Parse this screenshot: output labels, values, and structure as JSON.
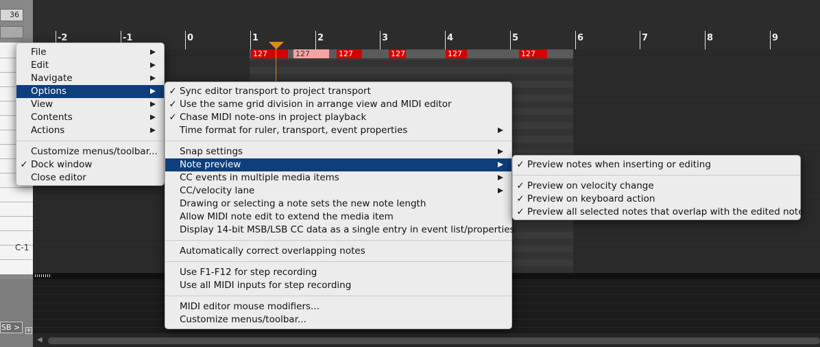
{
  "editor": {
    "zoom_value": "36",
    "key_label": "C-1",
    "cc_lane_label": "SB >",
    "add_lane_symbol": "+",
    "scroll_left_symbol": "◀",
    "ruler_labels": [
      "-2",
      "-1",
      "0",
      "1",
      "2",
      "3",
      "4",
      "5",
      "6",
      "7",
      "8",
      "9"
    ],
    "velocities": [
      "127",
      "127",
      "127",
      "127",
      "127",
      "127"
    ],
    "colors": {
      "note": "#d40000",
      "note_selected": "#f4a3a3",
      "playhead": "#e08a12",
      "menu_highlight": "#0e3f7c"
    }
  },
  "main_menu": {
    "items": [
      {
        "label": "File",
        "check": "",
        "submenu": true,
        "selected": false
      },
      {
        "label": "Edit",
        "check": "",
        "submenu": true,
        "selected": false
      },
      {
        "label": "Navigate",
        "check": "",
        "submenu": true,
        "selected": false
      },
      {
        "label": "Options",
        "check": "",
        "submenu": true,
        "selected": true
      },
      {
        "label": "View",
        "check": "",
        "submenu": true,
        "selected": false
      },
      {
        "label": "Contents",
        "check": "",
        "submenu": true,
        "selected": false
      },
      {
        "label": "Actions",
        "check": "",
        "submenu": true,
        "selected": false
      },
      {
        "label": "Customize menus/toolbar...",
        "check": "",
        "submenu": false,
        "selected": false
      },
      {
        "label": "Dock window",
        "check": "✓",
        "submenu": false,
        "selected": false
      },
      {
        "label": "Close editor",
        "check": "",
        "submenu": false,
        "selected": false
      }
    ]
  },
  "options_menu": {
    "items": [
      {
        "label": "Sync editor transport to project transport",
        "check": "✓",
        "submenu": false,
        "selected": false
      },
      {
        "label": "Use the same grid division in arrange view and MIDI editor",
        "check": "✓",
        "submenu": false,
        "selected": false
      },
      {
        "label": "Chase MIDI note-ons in project playback",
        "check": "✓",
        "submenu": false,
        "selected": false
      },
      {
        "label": "Time format for ruler, transport, event properties",
        "check": "",
        "submenu": true,
        "selected": false
      },
      {
        "label": "Snap settings",
        "check": "",
        "submenu": true,
        "selected": false
      },
      {
        "label": "Note preview",
        "check": "",
        "submenu": true,
        "selected": true
      },
      {
        "label": "CC events in multiple media items",
        "check": "",
        "submenu": true,
        "selected": false
      },
      {
        "label": "CC/velocity lane",
        "check": "",
        "submenu": true,
        "selected": false
      },
      {
        "label": "Drawing or selecting a note sets the new note length",
        "check": "",
        "submenu": false,
        "selected": false
      },
      {
        "label": "Allow MIDI note edit to extend the media item",
        "check": "",
        "submenu": false,
        "selected": false
      },
      {
        "label": "Display 14-bit MSB/LSB CC data as a single entry in event list/properties",
        "check": "",
        "submenu": false,
        "selected": false
      },
      {
        "label": "Automatically correct overlapping notes",
        "check": "",
        "submenu": false,
        "selected": false
      },
      {
        "label": "Use F1-F12 for step recording",
        "check": "",
        "submenu": false,
        "selected": false
      },
      {
        "label": "Use all MIDI inputs for step recording",
        "check": "",
        "submenu": false,
        "selected": false
      },
      {
        "label": "MIDI editor mouse modifiers...",
        "check": "",
        "submenu": false,
        "selected": false
      },
      {
        "label": "Customize menus/toolbar...",
        "check": "",
        "submenu": false,
        "selected": false
      }
    ]
  },
  "preview_menu": {
    "items": [
      {
        "label": "Preview notes when inserting or editing",
        "check": "✓"
      },
      {
        "label": "Preview on velocity change",
        "check": "✓"
      },
      {
        "label": "Preview on keyboard action",
        "check": "✓"
      },
      {
        "label": "Preview all selected notes that overlap with the edited note",
        "check": "✓"
      }
    ]
  }
}
